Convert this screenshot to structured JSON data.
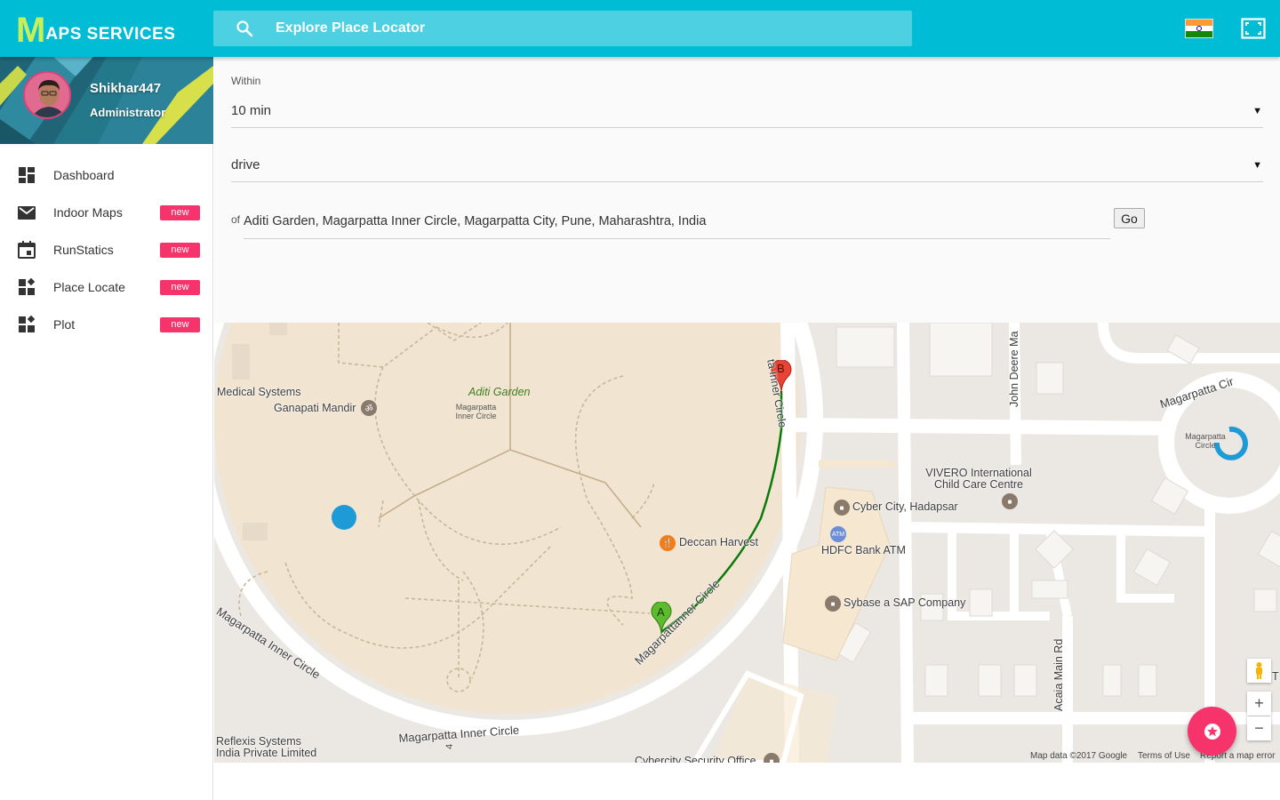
{
  "app": {
    "logo_initial": "M",
    "logo_rest": "APS SERVICES"
  },
  "search": {
    "placeholder": "Explore Place Locator"
  },
  "header": {
    "flag_icon": "india-flag-icon",
    "fullscreen_icon": "fullscreen-icon"
  },
  "user": {
    "name": "Shikhar447",
    "role": "Administrator"
  },
  "sidebar": {
    "items": [
      {
        "label": "Dashboard",
        "icon": "dashboard-icon",
        "badge": ""
      },
      {
        "label": "Indoor Maps",
        "icon": "mail-icon",
        "badge": "new"
      },
      {
        "label": "RunStatics",
        "icon": "calendar-icon",
        "badge": "new"
      },
      {
        "label": "Place Locate",
        "icon": "widgets-icon",
        "badge": "new"
      },
      {
        "label": "Plot",
        "icon": "widgets-icon",
        "badge": "new"
      }
    ]
  },
  "form": {
    "within_label": "Within",
    "within_value": "10 min",
    "mode_value": "drive",
    "address_prefix": "of",
    "address_value": "Aditi Garden, Magarpatta Inner Circle, Magarpatta City, Pune, Maharashtra, India",
    "go_label": "Go"
  },
  "map": {
    "labels": {
      "medical_systems": "Medical Systems",
      "ganapati_mandir": "Ganapati Mandir",
      "aditi_garden": "Aditi Garden",
      "magarpatta_inner_circle_small": "Magarpatta Inner Circle",
      "inner_circle_road_top": "ta Inner Circle",
      "john_deere": "John Deere Ma",
      "magarpatta_cir": "Magarpatta Cir",
      "magarpatta_circle_small": "Magarpatta Circle",
      "vivero": "VIVERO International Child Care Centre",
      "cyber_city": "Cyber City, Hadapsar",
      "hdfc_atm": "HDFC Bank ATM",
      "atm_badge": "ATM",
      "deccan_harvest": "Deccan Harvest",
      "sybase": "Sybase a SAP Company",
      "acaia_main_rd": "Acaia Main Rd",
      "road_left": "Magarpatta Inner Circle",
      "road_bottom": "Magarpatta Inner Circle",
      "road_route": "Magarpattanner Circle",
      "reflexis": "Reflexis Systems India Private Limited",
      "cybercity_security": "Cybercity Security Office",
      "edge_t": "T",
      "marker_a": "A",
      "marker_b": "B",
      "road_number": "4"
    },
    "footer": {
      "map_data": "Map data ©2017 Google",
      "terms": "Terms of Use",
      "report": "Report a map error"
    },
    "zoom_in": "+",
    "zoom_out": "−",
    "route_color": "#0a7a0a",
    "park_color": "#f0e4d0"
  }
}
